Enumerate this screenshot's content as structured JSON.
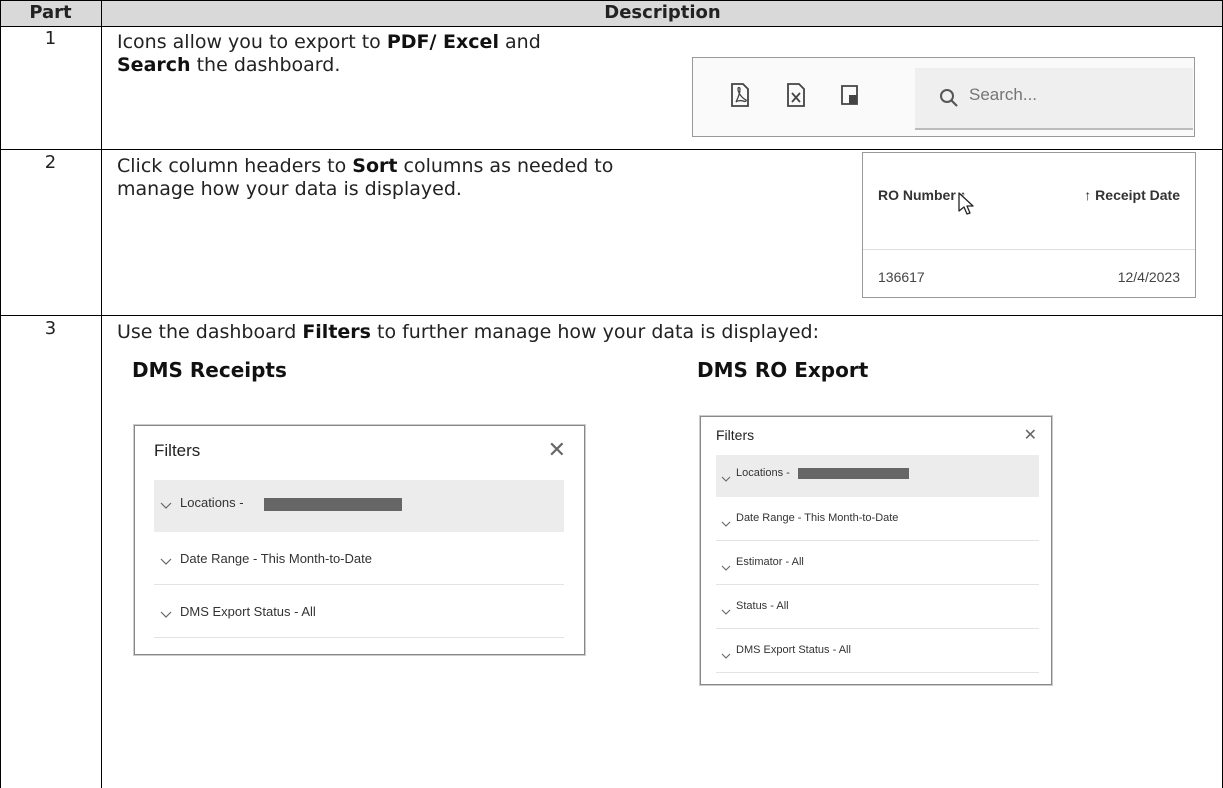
{
  "table": {
    "col_part": "Part",
    "col_description": "Description"
  },
  "rows": [
    {
      "part": "1",
      "line1_pre": "Icons allow you to export to ",
      "line1_bold": "PDF/ Excel",
      "line1_post": " and",
      "line2_bold": "Search",
      "line2_post": " the dashboard."
    },
    {
      "part": "2",
      "line1_pre": "Click column headers to ",
      "line1_bold": "Sort",
      "line1_post": " columns as needed to",
      "line2": "manage how your data is displayed."
    },
    {
      "part": "3",
      "line1_pre": "Use the dashboard ",
      "line1_bold": "Filters",
      "line1_post": " to further manage how your data is displayed:",
      "section_left": "DMS Receipts",
      "section_right": "DMS RO Export"
    }
  ],
  "toolbar": {
    "icons": [
      "pdf-export-icon",
      "excel-export-icon",
      "image-export-icon"
    ],
    "search_placeholder": "Search..."
  },
  "sort": {
    "header1": "RO Number ↑",
    "header2": "↑ Receipt Date",
    "value1": "136617",
    "value2": "12/4/2023"
  },
  "filters_receipts": {
    "title": "Filters",
    "close": "✕",
    "items": [
      "Locations - ",
      "Date Range - This Month-to-Date",
      "DMS Export Status - All"
    ]
  },
  "filters_ro_export": {
    "title": "Filters",
    "close": "✕",
    "items": [
      "Locations - ",
      "Date Range - This Month-to-Date",
      "Estimator - All",
      "Status - All",
      "DMS Export Status - All"
    ]
  }
}
